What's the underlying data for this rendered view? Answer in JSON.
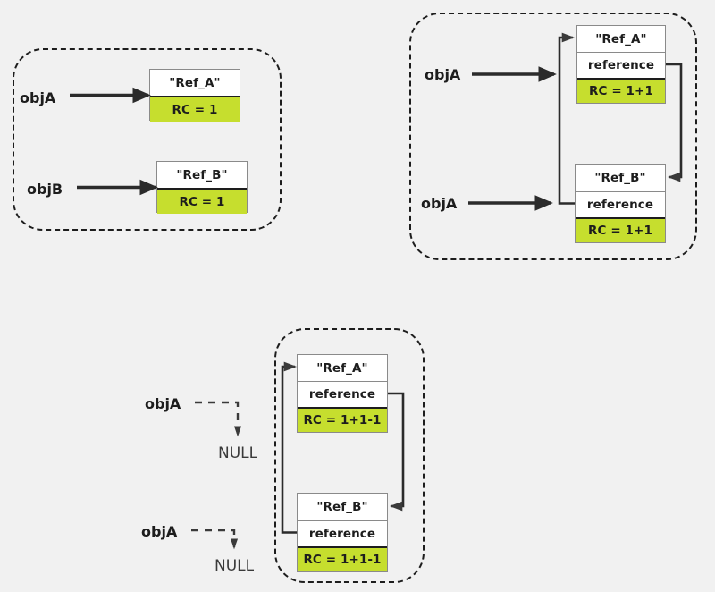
{
  "diagram": {
    "title": "Reference counting with circular references",
    "colors": {
      "background": "#f1f1f1",
      "rc_highlight": "#c6de2e",
      "box_border": "#8a8a8a",
      "stroke": "#1d1d1d",
      "null_text": "#3a3a3a"
    },
    "panels": [
      {
        "id": "panel-independent-objects",
        "labels": [
          {
            "name": "objA-label-p1",
            "text": "objA"
          },
          {
            "name": "objB-label-p1",
            "text": "objB"
          }
        ],
        "boxes": [
          {
            "id": "box-ref-a-p1",
            "rows": [
              {
                "kind": "title",
                "text": "\"Ref_A\""
              },
              {
                "kind": "rc",
                "text": "RC = 1"
              }
            ]
          },
          {
            "id": "box-ref-b-p1",
            "rows": [
              {
                "kind": "title",
                "text": "\"Ref_B\""
              },
              {
                "kind": "rc",
                "text": "RC = 1"
              }
            ]
          }
        ]
      },
      {
        "id": "panel-circular-references",
        "labels": [
          {
            "name": "objA-label-p2-top",
            "text": "objA"
          },
          {
            "name": "objA-label-p2-bottom",
            "text": "objA"
          }
        ],
        "boxes": [
          {
            "id": "box-ref-a-p2",
            "rows": [
              {
                "kind": "title",
                "text": "\"Ref_A\""
              },
              {
                "kind": "ref",
                "text": "reference"
              },
              {
                "kind": "rc",
                "text": "RC = 1+1"
              }
            ]
          },
          {
            "id": "box-ref-b-p2",
            "rows": [
              {
                "kind": "title",
                "text": "\"Ref_B\""
              },
              {
                "kind": "ref",
                "text": "reference"
              },
              {
                "kind": "rc",
                "text": "RC = 1+1"
              }
            ]
          }
        ]
      },
      {
        "id": "panel-references-dropped",
        "labels": [
          {
            "name": "objA-label-p3-top",
            "text": "objA"
          },
          {
            "name": "objA-label-p3-bottom",
            "text": "objA"
          },
          {
            "name": "null-label-p3-top",
            "text": "NULL"
          },
          {
            "name": "null-label-p3-bottom",
            "text": "NULL"
          }
        ],
        "boxes": [
          {
            "id": "box-ref-a-p3",
            "rows": [
              {
                "kind": "title",
                "text": "\"Ref_A\""
              },
              {
                "kind": "ref",
                "text": "reference"
              },
              {
                "kind": "rc",
                "text": "RC = 1+1-1"
              }
            ]
          },
          {
            "id": "box-ref-b-p3",
            "rows": [
              {
                "kind": "title",
                "text": "\"Ref_B\""
              },
              {
                "kind": "ref",
                "text": "reference"
              },
              {
                "kind": "rc",
                "text": "RC = 1+1-1"
              }
            ]
          }
        ]
      }
    ]
  }
}
